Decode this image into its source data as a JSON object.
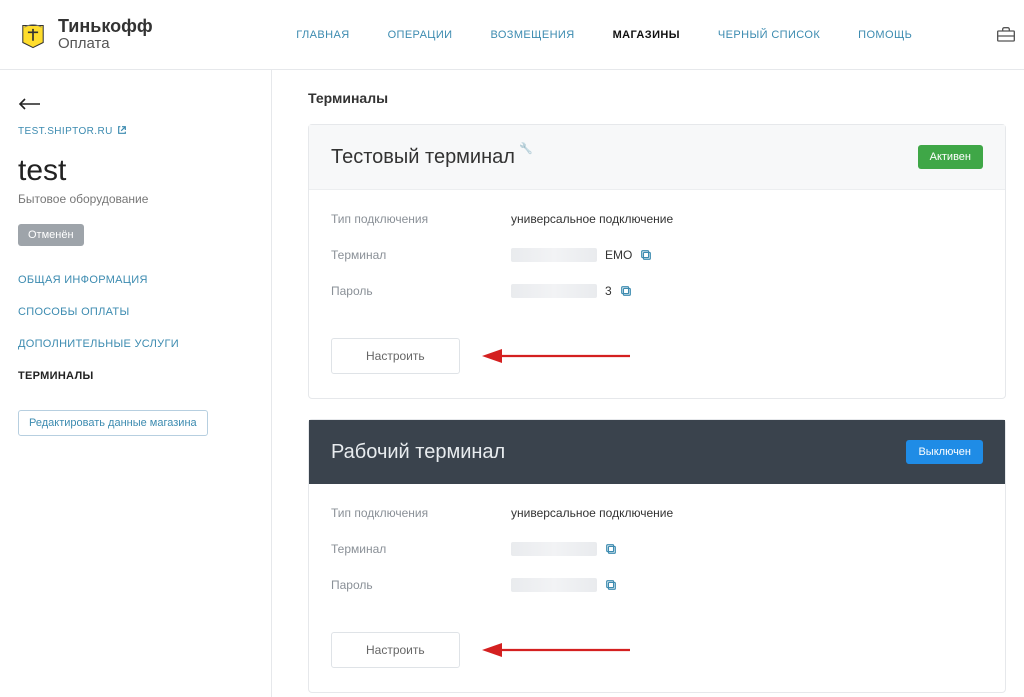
{
  "brand": {
    "line1": "Тинькофф",
    "line2": "Оплата"
  },
  "nav": {
    "items": [
      {
        "label": "ГЛАВНАЯ"
      },
      {
        "label": "ОПЕРАЦИИ"
      },
      {
        "label": "ВОЗМЕЩЕНИЯ"
      },
      {
        "label": "МАГАЗИНЫ"
      },
      {
        "label": "ЧЕРНЫЙ СПИСОК"
      },
      {
        "label": "ПОМОЩЬ"
      }
    ],
    "active_index": 3
  },
  "sidebar": {
    "store_url": "TEST.SHIPTOR.RU",
    "store_name": "test",
    "store_category": "Бытовое оборудование",
    "status_chip": "Отменён",
    "menu": [
      {
        "label": "ОБЩАЯ ИНФОРМАЦИЯ"
      },
      {
        "label": "СПОСОБЫ ОПЛАТЫ"
      },
      {
        "label": "ДОПОЛНИТЕЛЬНЫЕ УСЛУГИ"
      },
      {
        "label": "ТЕРМИНАЛЫ"
      }
    ],
    "menu_active_index": 3,
    "edit_button": "Редактировать данные магазина"
  },
  "main": {
    "page_title": "Терминалы",
    "labels": {
      "conn_type": "Тип подключения",
      "terminal": "Терминал",
      "password": "Пароль",
      "configure": "Настроить"
    },
    "cards": [
      {
        "title": "Тестовый терминал",
        "badge": "Активен",
        "badge_class": "green",
        "head_class": "light",
        "conn_value": "универсальное подключение",
        "terminal_suffix": "EMO",
        "password_suffix": "3"
      },
      {
        "title": "Рабочий терминал",
        "badge": "Выключен",
        "badge_class": "blue",
        "head_class": "dark",
        "conn_value": "универсальное подключение",
        "terminal_suffix": "",
        "password_suffix": ""
      }
    ]
  }
}
